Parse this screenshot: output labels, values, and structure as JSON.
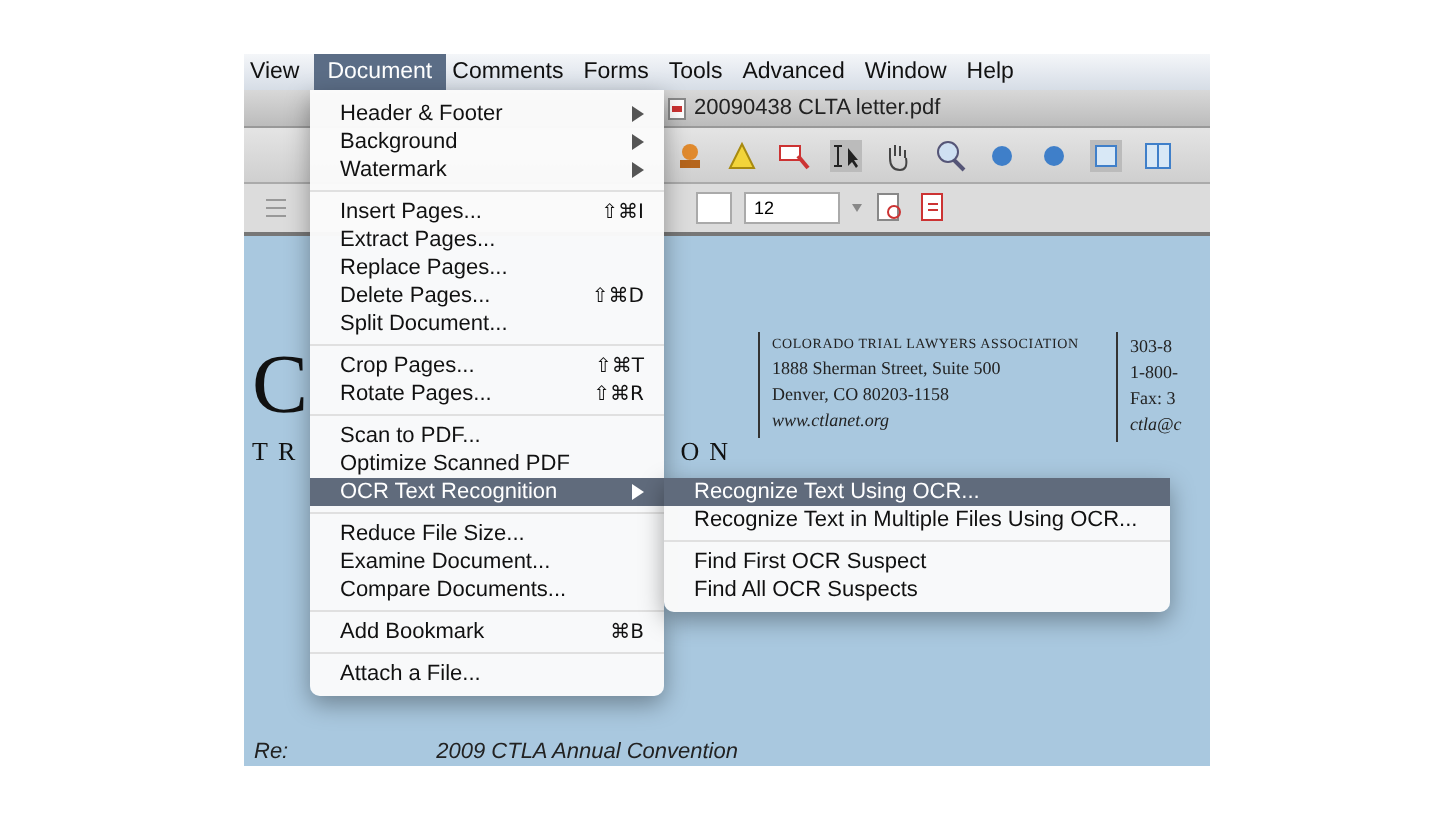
{
  "menu_bar": [
    {
      "label": "View",
      "selected": false
    },
    {
      "label": "Document",
      "selected": true
    },
    {
      "label": "Comments",
      "selected": false
    },
    {
      "label": "Forms",
      "selected": false
    },
    {
      "label": "Tools",
      "selected": false
    },
    {
      "label": "Advanced",
      "selected": false
    },
    {
      "label": "Window",
      "selected": false
    },
    {
      "label": "Help",
      "selected": false
    }
  ],
  "window": {
    "title": "20090438 CLTA letter.pdf"
  },
  "toolbar2": {
    "page_field": "12"
  },
  "document": {
    "logo_letter": "C",
    "logo_left": "TR",
    "logo_right": "ON",
    "address": [
      "COLORADO TRIAL LAWYERS ASSOCIATION",
      "1888 Sherman Street, Suite 500",
      "Denver, CO 80203-1158",
      "www.ctlanet.org"
    ],
    "contact": [
      "303-8",
      "1-800-",
      "Fax: 3",
      "ctla@c"
    ],
    "re_label": "Re:",
    "re_text": "2009 CTLA Annual Convention"
  },
  "document_menu": [
    [
      {
        "label": "Header & Footer",
        "has_submenu": true,
        "selected": false
      },
      {
        "label": "Background",
        "has_submenu": true,
        "selected": false
      },
      {
        "label": "Watermark",
        "has_submenu": true,
        "selected": false
      }
    ],
    [
      {
        "label": "Insert Pages...",
        "shortcut": "⇧⌘I",
        "has_submenu": false,
        "selected": false
      },
      {
        "label": "Extract Pages...",
        "has_submenu": false,
        "selected": false
      },
      {
        "label": "Replace Pages...",
        "has_submenu": false,
        "selected": false
      },
      {
        "label": "Delete Pages...",
        "shortcut": "⇧⌘D",
        "has_submenu": false,
        "selected": false
      },
      {
        "label": "Split Document...",
        "has_submenu": false,
        "selected": false
      }
    ],
    [
      {
        "label": "Crop Pages...",
        "shortcut": "⇧⌘T",
        "has_submenu": false,
        "selected": false
      },
      {
        "label": "Rotate Pages...",
        "shortcut": "⇧⌘R",
        "has_submenu": false,
        "selected": false
      }
    ],
    [
      {
        "label": "Scan to PDF...",
        "has_submenu": false,
        "selected": false
      },
      {
        "label": "Optimize Scanned PDF",
        "has_submenu": false,
        "selected": false
      },
      {
        "label": "OCR Text Recognition",
        "has_submenu": true,
        "selected": true
      }
    ],
    [
      {
        "label": "Reduce File Size...",
        "has_submenu": false,
        "selected": false
      },
      {
        "label": "Examine Document...",
        "has_submenu": false,
        "selected": false
      },
      {
        "label": "Compare Documents...",
        "has_submenu": false,
        "selected": false
      }
    ],
    [
      {
        "label": "Add Bookmark",
        "shortcut": "⌘B",
        "has_submenu": false,
        "selected": false
      }
    ],
    [
      {
        "label": "Attach a File...",
        "has_submenu": false,
        "selected": false
      }
    ]
  ],
  "ocr_submenu": [
    [
      {
        "label": "Recognize Text Using OCR...",
        "selected": true
      },
      {
        "label": "Recognize Text in Multiple Files Using OCR...",
        "selected": false
      }
    ],
    [
      {
        "label": "Find First OCR Suspect",
        "selected": false
      },
      {
        "label": "Find All OCR Suspects",
        "selected": false
      }
    ]
  ]
}
